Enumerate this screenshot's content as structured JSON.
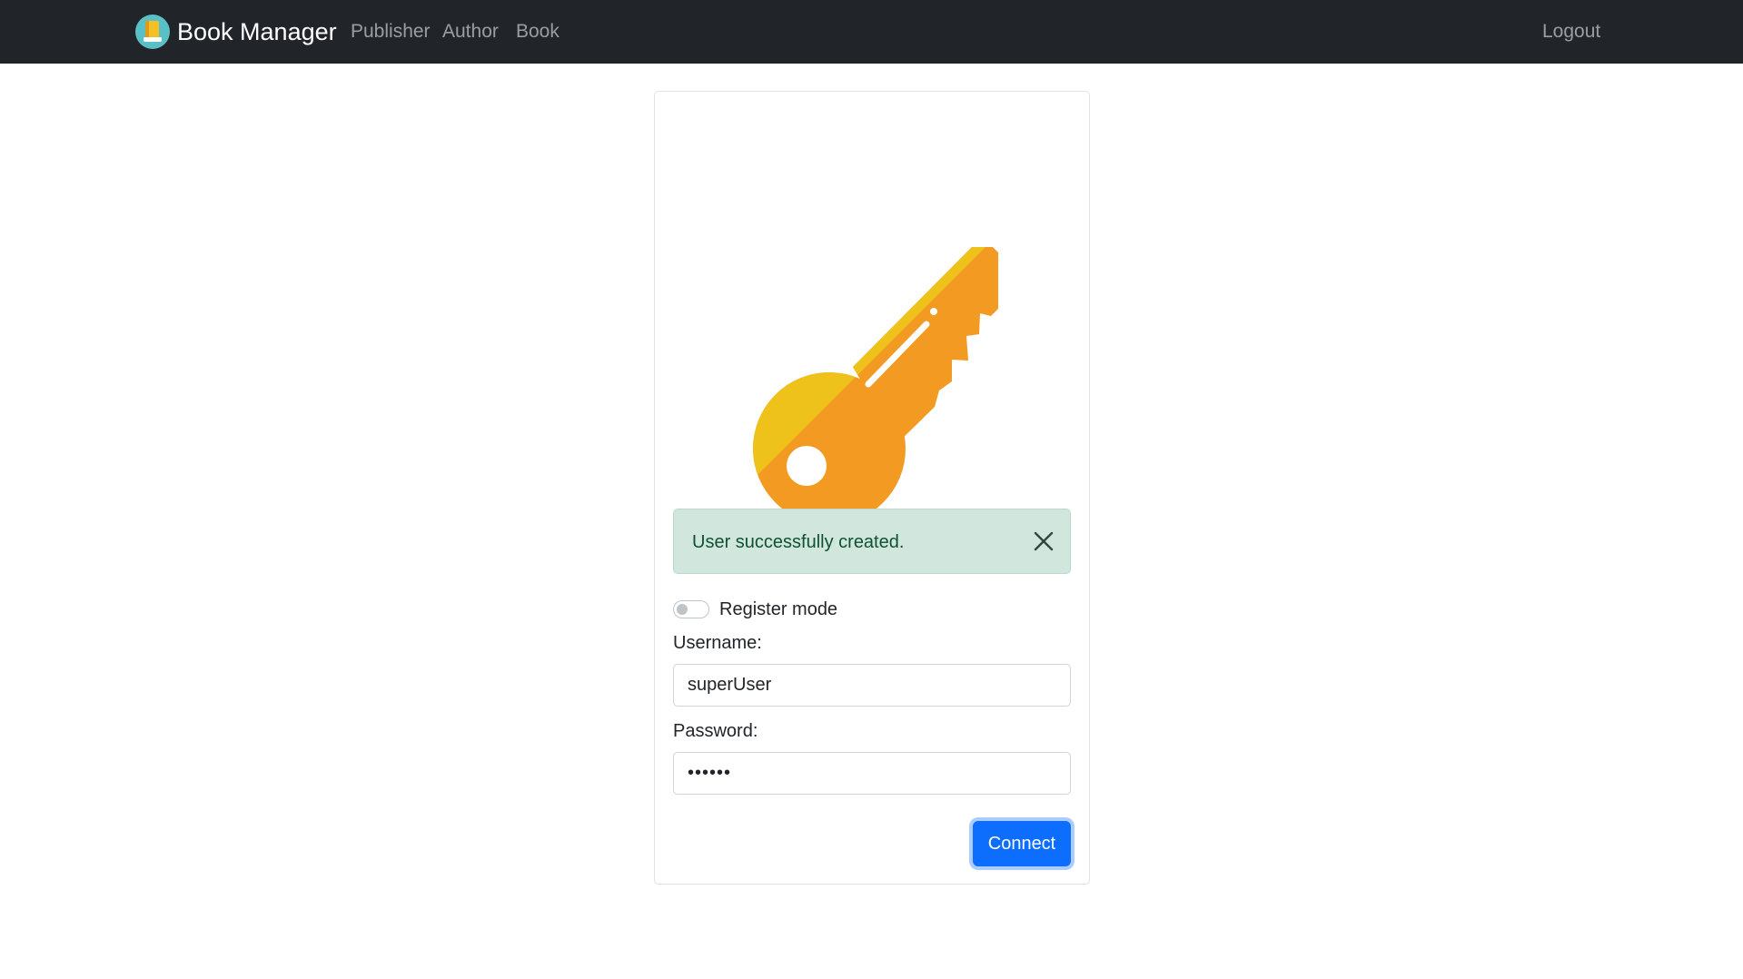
{
  "navbar": {
    "brand": "Book Manager",
    "links": [
      "Publisher",
      "Author",
      "Book"
    ],
    "logout": "Logout"
  },
  "alert": {
    "message": "User successfully created."
  },
  "login_form": {
    "register_mode_label": "Register mode",
    "register_mode_on": false,
    "username_label": "Username:",
    "username_value": "superUser",
    "password_label": "Password:",
    "password_value": "••••••",
    "submit_label": "Connect"
  },
  "colors": {
    "navbar_bg": "#212529",
    "primary": "#0d6efd",
    "alert_bg": "#d1e7dd",
    "key_light": "#efc11b",
    "key_dark": "#f29a22"
  },
  "icons": {
    "brand": "book-logo-icon",
    "illustration": "key-icon",
    "alert_close": "close-icon"
  }
}
